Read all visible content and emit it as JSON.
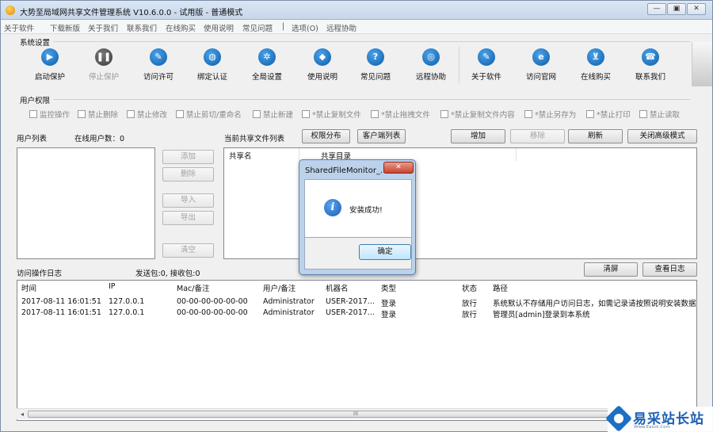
{
  "window": {
    "title": "大势至局域网共享文件管理系统 V10.6.0.0 - 试用版 - 普通模式",
    "controls": [
      "—",
      "▣",
      "✕"
    ]
  },
  "menu": [
    "关于软件",
    "下载新版",
    "关于我们",
    "联系我们",
    "在线购买",
    "使用说明",
    "常见问题",
    "|",
    "选项(O)",
    "远程协助"
  ],
  "system_settings": {
    "label": "系统设置",
    "tools": [
      {
        "label": "启动保护",
        "icon": "play-icon",
        "glyph": "▶",
        "disabled": false
      },
      {
        "label": "停止保护",
        "icon": "pause-icon",
        "glyph": "❚❚",
        "disabled": true
      },
      {
        "label": "访问许可",
        "icon": "key-icon",
        "glyph": "✎",
        "disabled": false
      },
      {
        "label": "绑定认证",
        "icon": "globe-lock-icon",
        "glyph": "◍",
        "disabled": false
      },
      {
        "label": "全局设置",
        "icon": "gear-icon",
        "glyph": "✲",
        "disabled": false
      },
      {
        "label": "使用说明",
        "icon": "graduation-cap-icon",
        "glyph": "◆",
        "disabled": false
      },
      {
        "label": "常见问题",
        "icon": "question-icon",
        "glyph": "?",
        "disabled": false
      },
      {
        "label": "远程协助",
        "icon": "remote-globe-icon",
        "glyph": "◎",
        "disabled": false
      },
      {
        "label": "关于软件",
        "icon": "about-icon",
        "glyph": "✎",
        "disabled": false
      },
      {
        "label": "访问官网",
        "icon": "browser-icon",
        "glyph": "e",
        "disabled": false
      },
      {
        "label": "在线购买",
        "icon": "cart-icon",
        "glyph": "⊻",
        "disabled": false
      },
      {
        "label": "联系我们",
        "icon": "phone-icon",
        "glyph": "☎",
        "disabled": false
      }
    ]
  },
  "user_permissions": {
    "label": "用户权限",
    "options": [
      "监控操作",
      "禁止删除",
      "禁止修改",
      "禁止剪切/重命名",
      "禁止新建",
      "*禁止复制文件",
      "*禁止拖拽文件",
      "*禁止复制文件内容",
      "*禁止另存为",
      "*禁止打印",
      "禁止读取"
    ]
  },
  "user_list": {
    "label": "用户列表",
    "online_label": "在线用户数：0"
  },
  "user_buttons": [
    "添加",
    "删除",
    "导入",
    "导出",
    "清空"
  ],
  "share_list": {
    "label": "当前共享文件列表",
    "buttons": {
      "perm": "权限分布",
      "client": "客户端列表",
      "add": "增加",
      "remove": "移除",
      "refresh": "刷新",
      "close_adv": "关闭高级模式"
    },
    "columns": [
      "共享名",
      "共享目录"
    ]
  },
  "log": {
    "label": "访问操作日志",
    "packets": "发送包:0, 接收包:0",
    "clear": "清屏",
    "view": "查看日志",
    "columns": [
      "时间",
      "IP",
      "Mac/备注",
      "用户/备注",
      "机器名",
      "类型",
      "状态",
      "路径"
    ],
    "rows": [
      [
        "2017-08-11 16:01:51",
        "127.0.0.1",
        "00-00-00-00-00-00",
        "Administrator",
        "USER-2017...",
        "登录",
        "放行",
        "系统默认不存储用户访问日志，如需记录请按照说明安装数据库"
      ],
      [
        "2017-08-11 16:01:51",
        "127.0.0.1",
        "00-00-00-00-00-00",
        "Administrator",
        "USER-2017...",
        "登录",
        "放行",
        "管理员[admin]登录到本系统"
      ]
    ],
    "scroll_left": "◂",
    "scroll_right": "▸",
    "scroll_grip": "III"
  },
  "dialog": {
    "title": "SharedFileMonitor_...",
    "close": "✕",
    "message": "安装成功!",
    "ok": "确定"
  },
  "watermark": {
    "text": "易采站长站",
    "sub": "Www.Easck.Com"
  }
}
